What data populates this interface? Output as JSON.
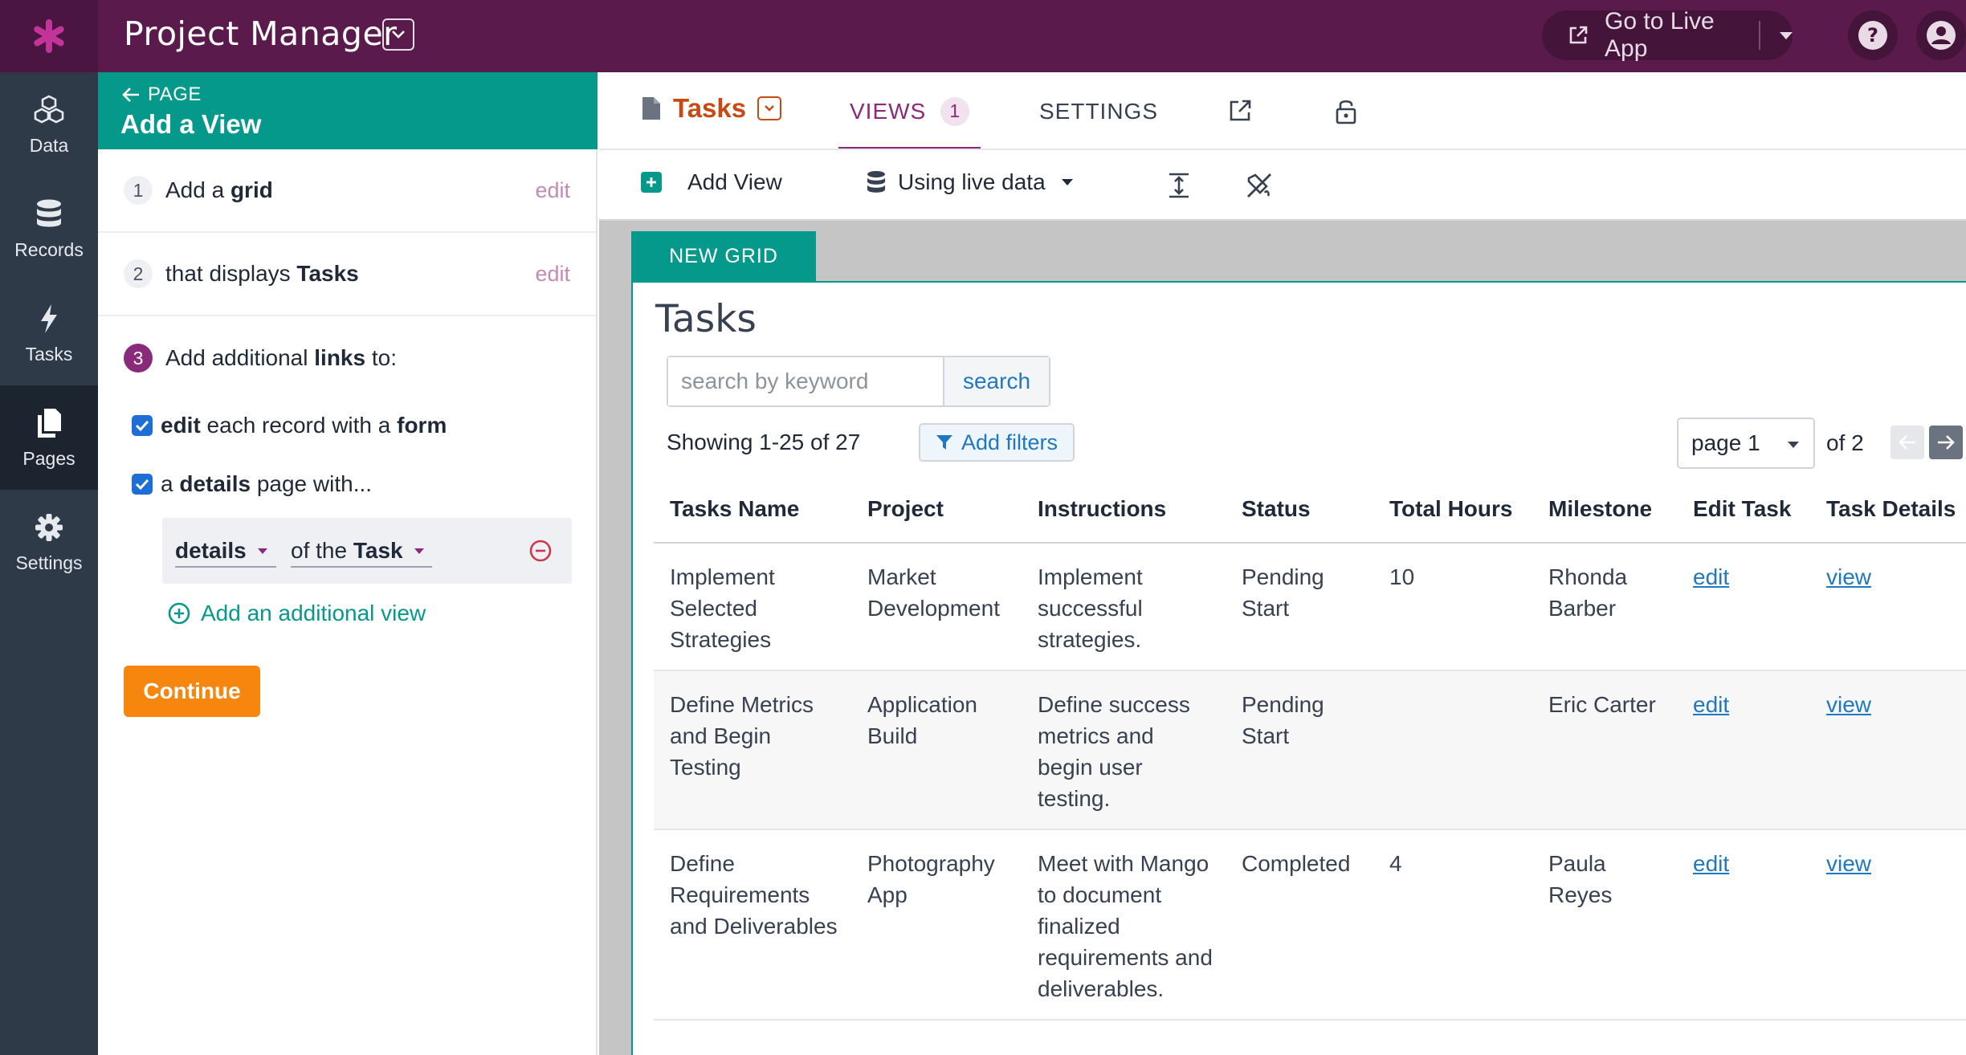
{
  "topbar": {
    "app_title": "Project Manager",
    "live_app_label": "Go to Live App",
    "brand_color": "#5a1b4c"
  },
  "leftnav": {
    "items": [
      {
        "label": "Data",
        "icon": "cubes-icon"
      },
      {
        "label": "Records",
        "icon": "database-icon"
      },
      {
        "label": "Tasks",
        "icon": "bolt-icon"
      },
      {
        "label": "Pages",
        "icon": "pages-icon",
        "active": true
      },
      {
        "label": "Settings",
        "icon": "gear-icon"
      }
    ]
  },
  "builder": {
    "back_label": "PAGE",
    "title": "Add a View",
    "steps": [
      {
        "num": "1",
        "prefix": "Add a ",
        "bold": "grid",
        "edit": "edit"
      },
      {
        "num": "2",
        "prefix": "that displays ",
        "bold": "Tasks",
        "edit": "edit"
      },
      {
        "num": "3",
        "prefix": "Add additional ",
        "bold": "links",
        "suffix": " to:"
      }
    ],
    "options": [
      {
        "b1": "edit",
        "mid": " each record with a ",
        "b2": "form",
        "checked": true
      },
      {
        "pre": "a ",
        "b1": "details",
        "mid": " page with...",
        "checked": true
      }
    ],
    "details_select": "details",
    "of_the_prefix": "of the ",
    "of_the_select": "Task",
    "add_view_label": "Add an additional view",
    "continue_label": "Continue"
  },
  "main": {
    "tabs": {
      "tasks": "Tasks",
      "views": "VIEWS",
      "views_count": "1",
      "settings": "SETTINGS"
    },
    "toolbar": {
      "add_view": "Add View",
      "data_mode": "Using live data"
    },
    "grid_tab": "NEW GRID",
    "canvas_title": "Tasks",
    "search": {
      "placeholder": "search by keyword",
      "button": "search"
    },
    "showing": "Showing 1-25 of 27",
    "add_filters": "Add filters",
    "page_select": "page 1",
    "of_pages": "of 2"
  },
  "table": {
    "headers": [
      "Tasks Name",
      "Project",
      "Instructions",
      "Status",
      "Total Hours",
      "Milestone",
      "Edit Task",
      "Task Details"
    ],
    "rows": [
      {
        "name": "Implement Selected Strategies",
        "project": "Market Development",
        "instructions": "Implement successful strategies.",
        "status": "Pending Start",
        "hours": "10",
        "milestone": "Rhonda Barber",
        "edit": "edit",
        "view": "view"
      },
      {
        "name": "Define Metrics and Begin Testing",
        "project": "Application Build",
        "instructions": "Define success metrics and begin user testing.",
        "status": "Pending Start",
        "hours": "",
        "milestone": "Eric Carter",
        "edit": "edit",
        "view": "view"
      },
      {
        "name": "Define Requirements and Deliverables",
        "project": "Photography App",
        "instructions": "Meet with Mango to document finalized requirements and deliverables.",
        "status": "Completed",
        "hours": "4",
        "milestone": "Paula Reyes",
        "edit": "edit",
        "view": "view"
      }
    ]
  }
}
